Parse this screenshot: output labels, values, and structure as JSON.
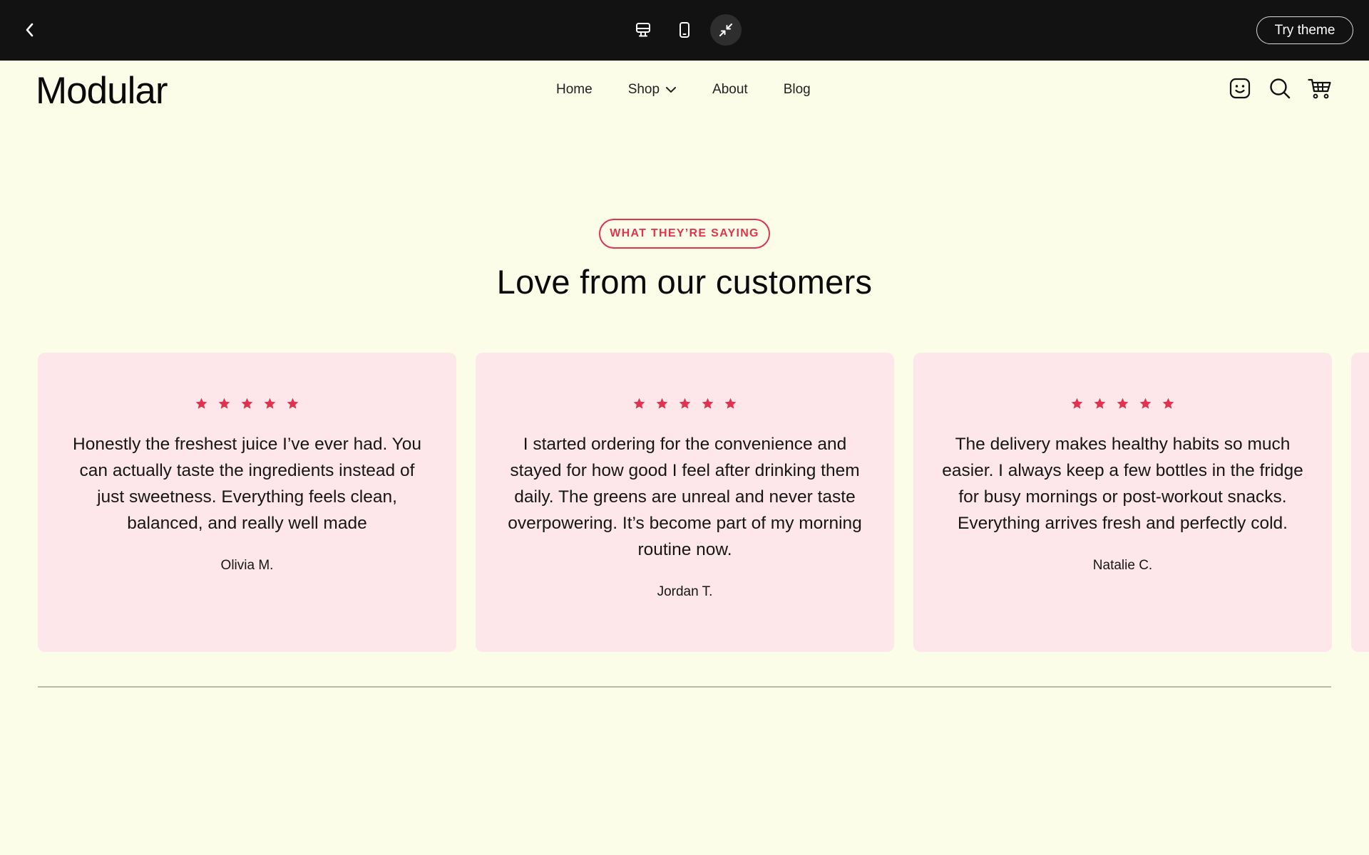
{
  "preview_bar": {
    "back_icon": "chevron-left-icon",
    "devices": [
      {
        "name": "desktop",
        "icon": "desktop-icon",
        "active": false
      },
      {
        "name": "mobile",
        "icon": "mobile-icon",
        "active": false
      },
      {
        "name": "collapse",
        "icon": "collapse-arrows-icon",
        "active": true
      }
    ],
    "try_theme_label": "Try theme"
  },
  "store": {
    "logo": "Modular",
    "nav": [
      {
        "label": "Home"
      },
      {
        "label": "Shop",
        "has_dropdown": true
      },
      {
        "label": "About"
      },
      {
        "label": "Blog"
      }
    ],
    "icons": [
      "account-smiley-icon",
      "search-icon",
      "cart-icon"
    ]
  },
  "testimonials": {
    "eyebrow": "WHAT THEY’RE SAYING",
    "title": "Love from our customers",
    "accent_color": "#e0344e",
    "card_color": "#fde7eb",
    "items": [
      {
        "rating": 5,
        "quote": "Honestly the freshest juice I’ve ever had. You can actually taste the ingredients instead of just sweetness. Everything feels clean, balanced, and really well made",
        "author": "Olivia M."
      },
      {
        "rating": 5,
        "quote": "I started ordering for the convenience and stayed for how good I feel after drinking them daily. The greens are unreal and never taste overpowering. It’s become part of my morning routine now.",
        "author": "Jordan T."
      },
      {
        "rating": 5,
        "quote": "The delivery makes healthy habits so much easier. I always keep a few bottles in the fridge for busy mornings or post-workout snacks. Everything arrives fresh and perfectly cold.",
        "author": "Natalie C."
      }
    ]
  }
}
